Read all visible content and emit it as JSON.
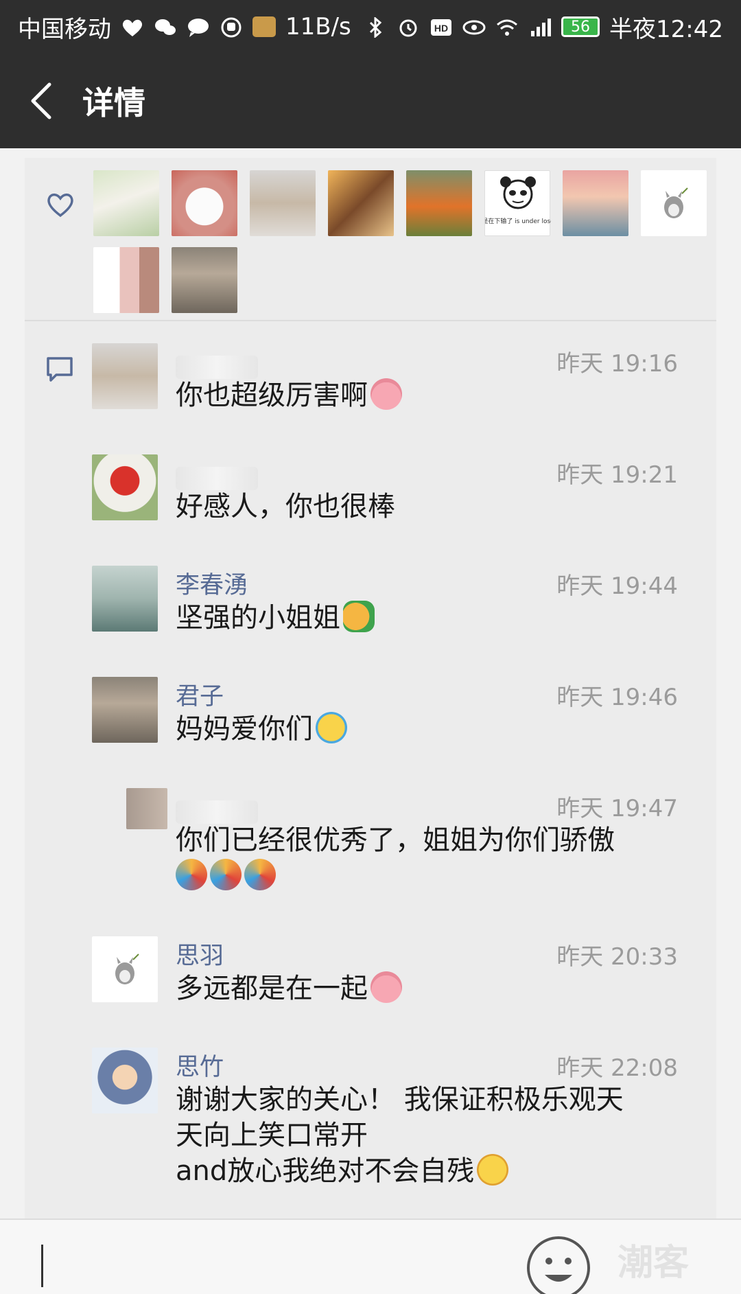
{
  "status_bar": {
    "carrier": "中国移动",
    "speed": "11B/s",
    "battery": "56",
    "time": "半夜12:42"
  },
  "header": {
    "back_icon": "chevron-left-icon",
    "title": "详情"
  },
  "likes": {
    "icon": "heart-outline-icon",
    "avatars": [
      "couple-bike",
      "white-cat-cartoon",
      "girl-portrait",
      "friends-group",
      "flowers-field",
      "panda-meme",
      "pink-sky-painting",
      "totoro-cartoon",
      "blurred-avatar",
      "girl-on-stairs"
    ],
    "panda_caption": "是在下输了 is under lose"
  },
  "comments": {
    "icon": "comment-bubble-icon",
    "items": [
      {
        "name": "",
        "time": "昨天 19:16",
        "text": "你也超级厉害啊",
        "emoji": "pig-emoji",
        "avatar": "girl-portrait"
      },
      {
        "name": "",
        "time": "昨天 19:21",
        "text": "好感人，你也很棒",
        "emoji": "",
        "avatar": "red-lantern"
      },
      {
        "name": "李春湧",
        "time": "昨天 19:44",
        "text": "坚强的小姐姐",
        "emoji": "thumbs-up-emoji",
        "avatar": "lake-ducks"
      },
      {
        "name": "君子",
        "time": "昨天 19:46",
        "text": "妈妈爱你们",
        "emoji": "crying-emoji",
        "avatar": "girl-on-stairs"
      },
      {
        "name": "",
        "time": "昨天 19:47",
        "text": "你们已经很优秀了，姐姐为你们骄傲",
        "emoji": "party-popper-emoji",
        "avatar": "blurred-avatar"
      },
      {
        "name": "思羽",
        "time": "昨天 20:33",
        "text": "多远都是在一起",
        "emoji": "pig-emoji",
        "avatar": "totoro-cartoon"
      },
      {
        "name": "思竹",
        "time": "昨天 22:08",
        "text_lines": [
          "谢谢大家的关心！ 我保证积极乐观天",
          "天向上笑口常开",
          "and放心我绝对不会自残"
        ],
        "emoji": "laughing-tears-emoji",
        "avatar": "cartoon-girl"
      }
    ]
  },
  "input_bar": {
    "emoji_button_icon": "smiley-icon",
    "watermark": "潮客"
  },
  "colors": {
    "header_bg": "#2e2e2e",
    "name_color": "#576b95",
    "card_bg": "#ececec"
  }
}
